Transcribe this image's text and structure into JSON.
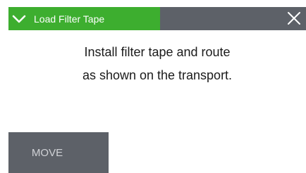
{
  "dialog": {
    "title": "Load Filter Tape",
    "icons": {
      "collapse": "chevron-down-icon",
      "close": "close-icon"
    },
    "message_lines": [
      "Install filter tape and route",
      "as shown on the transport."
    ],
    "move_button_label": "MOVE"
  },
  "colors": {
    "title_tab": "#3dae2f",
    "title_bar": "#5d6168",
    "button": "#5d6168",
    "button_text": "#d0d2d6"
  }
}
